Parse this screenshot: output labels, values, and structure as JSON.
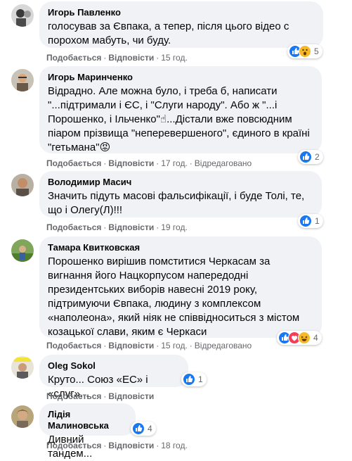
{
  "common": {
    "like_label": "Подобається",
    "reply_label": "Відповісти",
    "dot": "·",
    "edited_label": "Відредаговано"
  },
  "comments": [
    {
      "author": "Игорь Павленко",
      "text": "голосував за Євпака, а тепер, після цього відео с порохом мабуть, чи буду.",
      "time": "15 год.",
      "reactions": [
        "like",
        "wow"
      ],
      "reaction_count": "5",
      "edited": false
    },
    {
      "author": "Игорь Маринченко",
      "text": "Відрадно. Але можна було, і треба б, написати \"...підтримали і ЄС, і \"Слуги народу\". Або ж \"...і Порошенко, і Ільченко\"☝...Дістали вже повсюдним піаром прізвища \"неперевершеного\", єдиного в країні \"гетьмана\"😡",
      "time": "17 год.",
      "reactions": [
        "like"
      ],
      "reaction_count": "2",
      "edited": true
    },
    {
      "author": "Володимир Масич",
      "text": "Значить підуть масові фальсифікації, і буде Толі, те, що і Олегу(Л)!!!",
      "time": "19 год.",
      "reactions": [
        "like"
      ],
      "reaction_count": "1",
      "edited": false
    },
    {
      "author": "Тамара Квитковская",
      "text": "Порошенко вирішив помститися Черкасам за вигнання його Нацкорпусом напередодні президентських виборів навесні 2019 року, підтримуючи Євпака, людину з комплексом «наполеона», який ніяк не співвідноситься з містом козацької слави, яким є Черкаси",
      "time": "15 год.",
      "reactions": [
        "like",
        "love",
        "haha"
      ],
      "reaction_count": "4",
      "edited": true
    },
    {
      "author": "Oleg Sokol",
      "text": "Круто... Союз «ЕС» і «слуг»...",
      "time": "",
      "reactions": [
        "like"
      ],
      "reaction_count": "1",
      "edited": false
    },
    {
      "author": "Лідія Малиновська",
      "text": "Дивний тандем...",
      "time": "18 год.",
      "reactions": [
        "like"
      ],
      "reaction_count": "4",
      "edited": false
    }
  ],
  "colors": {
    "bubble": "#f0f2f5",
    "meta_text": "#65676b",
    "like_blue": "#1877f2",
    "love_red": "#f33e58",
    "haha_yellow": "#f7b928"
  }
}
